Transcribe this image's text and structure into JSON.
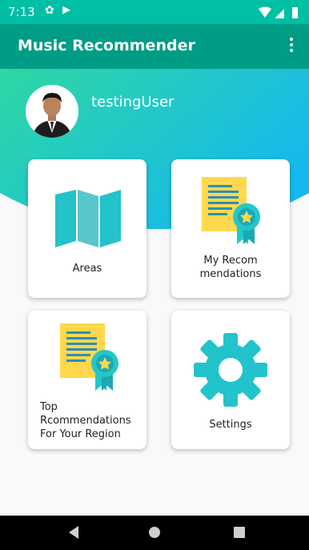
{
  "status_bar": {
    "time": "7:13",
    "icons": [
      "gear-icon",
      "play-store-icon",
      "wifi-icon",
      "signal-icon",
      "battery-icon"
    ]
  },
  "app_bar": {
    "title": "Music Recommender",
    "overflow_icon": "more-vert-icon"
  },
  "profile": {
    "username": "testingUser"
  },
  "cards": [
    {
      "label": "Areas",
      "icon": "map-icon"
    },
    {
      "label": "My Recom\nmendations",
      "icon": "certificate-icon"
    },
    {
      "label": "Top\nRcommendations\nFor Your Region",
      "icon": "certificate-icon"
    },
    {
      "label": "Settings",
      "icon": "gear-icon"
    }
  ],
  "nav_bar": {
    "buttons": [
      "back-icon",
      "home-icon",
      "recents-icon"
    ]
  },
  "colors": {
    "status_bar": "#00bfa5",
    "app_bar": "#009c86",
    "gradient_start": "#2ed7a2",
    "gradient_end": "#16b8ef",
    "accent_teal": "#20c4c4",
    "certificate_yellow": "#ffd84d"
  }
}
